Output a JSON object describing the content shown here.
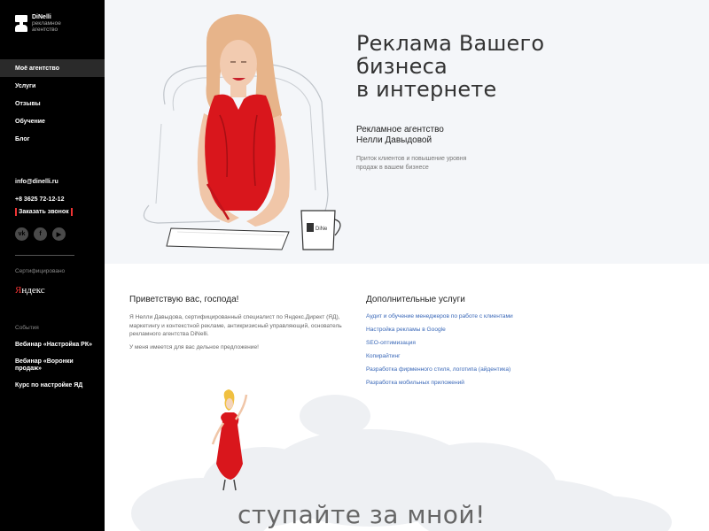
{
  "logo": {
    "name": "DiNelli",
    "sub1": "рекламное",
    "sub2": "агентство"
  },
  "nav": [
    {
      "label": "Моё агентство",
      "active": true
    },
    {
      "label": "Услуги"
    },
    {
      "label": "Отзывы"
    },
    {
      "label": "Обучение"
    },
    {
      "label": "Блог"
    }
  ],
  "contacts": {
    "email": "info@dinelli.ru",
    "phone": "+8 3625 72-12-12",
    "call": "Заказать звонок"
  },
  "social": [
    {
      "icon": "vk-icon",
      "glyph": "vk"
    },
    {
      "icon": "facebook-icon",
      "glyph": "f"
    },
    {
      "icon": "youtube-icon",
      "glyph": "▶"
    }
  ],
  "certified": {
    "label": "Сертифицировано",
    "brand_first": "Я",
    "brand_rest": "ндекс"
  },
  "events": {
    "label": "События",
    "items": [
      "Вебинар «Настройка РК»",
      "Вебинар «Воронки продаж»",
      "Курс по настройке ЯД"
    ]
  },
  "hero": {
    "title_l1": "Реклама Вашего",
    "title_l2": "бизнеса",
    "title_l3": "в интернете",
    "sub_l1": "Рекламное агентство",
    "sub_l2": "Нелли Давыдовой",
    "desc_l1": "Приток клиентов и повышение уровня",
    "desc_l2": "продаж в вашем бизнесе"
  },
  "greeting": {
    "title": "Приветствую вас, господа!",
    "text1": "Я Нелли Давыдова, сертифицированный специалист по Яндекс.Директ (ЯД), маркетингу и контекстной рекламе, антикризисный управляющий, основатель рекламного агентства DiNelli.",
    "text2": "У меня имеется для вас дельное предложение!"
  },
  "services": {
    "title": "Дополнительные услуги",
    "items": [
      "Аудит и обучение менеджеров по работе с клиентами",
      "Настройка рекламы в Google",
      "SEO-оптимизация",
      "Копирайтинг",
      "Разработка фирменного стиля, логотипа (айдентика)",
      "Разработка мобильных приложений"
    ]
  },
  "mug_text": "DiNe",
  "follow": "ступайте за мной!",
  "colors": {
    "sidebar_bg": "#000000",
    "link": "#3a68b8",
    "accent": "#e33333",
    "hero_bg": "#f4f6f9"
  }
}
